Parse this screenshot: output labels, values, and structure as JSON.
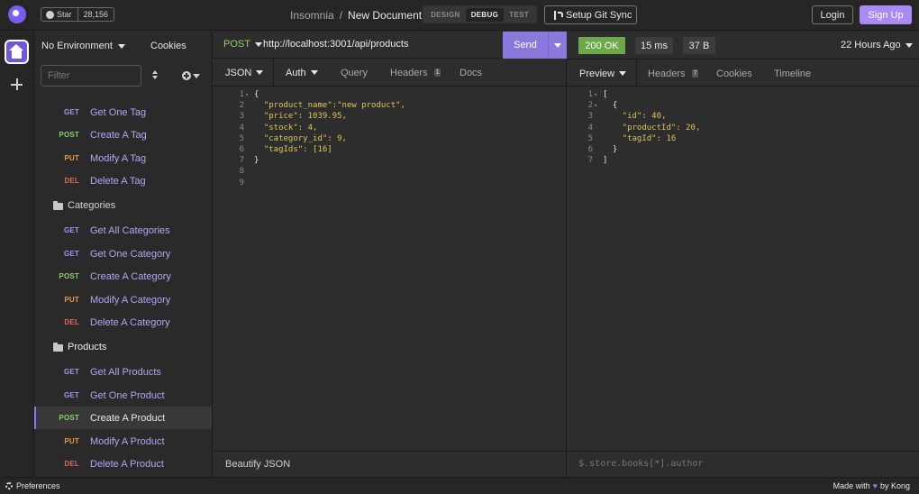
{
  "github": {
    "star_label": "Star",
    "star_count": "28,156"
  },
  "breadcrumb": {
    "workspace": "Insomnia",
    "separator": "/",
    "document": "New Document"
  },
  "modes": {
    "design": "DESIGN",
    "debug": "DEBUG",
    "test": "TEST",
    "active": "DEBUG"
  },
  "header_buttons": {
    "git_sync": "Setup Git Sync",
    "login": "Login",
    "signup": "Sign Up"
  },
  "colors": {
    "accent": "#8a78dd",
    "signup": "#a98bf3",
    "status_ok": "#6da94a",
    "get": "#a496f0",
    "post": "#8ed06c",
    "put": "#e49a4b",
    "del": "#e06868"
  },
  "sidebar": {
    "environment": "No Environment",
    "cookies": "Cookies",
    "filter_placeholder": "Filter",
    "items": [
      {
        "type": "request",
        "method": "GET",
        "name": "Get One Tag"
      },
      {
        "type": "request",
        "method": "POST",
        "name": "Create A Tag"
      },
      {
        "type": "request",
        "method": "PUT",
        "name": "Modify A Tag"
      },
      {
        "type": "request",
        "method": "DEL",
        "name": "Delete A Tag"
      },
      {
        "type": "folder",
        "name": "Categories"
      },
      {
        "type": "request",
        "method": "GET",
        "name": "Get All Categories"
      },
      {
        "type": "request",
        "method": "GET",
        "name": "Get One Category"
      },
      {
        "type": "request",
        "method": "POST",
        "name": "Create A Category"
      },
      {
        "type": "request",
        "method": "PUT",
        "name": "Modify A Category"
      },
      {
        "type": "request",
        "method": "DEL",
        "name": "Delete A Category"
      },
      {
        "type": "folder",
        "name": "Products"
      },
      {
        "type": "request",
        "method": "GET",
        "name": "Get All Products"
      },
      {
        "type": "request",
        "method": "GET",
        "name": "Get One Product"
      },
      {
        "type": "request",
        "method": "POST",
        "name": "Create A Product",
        "active": true
      },
      {
        "type": "request",
        "method": "PUT",
        "name": "Modify A Product"
      },
      {
        "type": "request",
        "method": "DEL",
        "name": "Delete A Product"
      }
    ]
  },
  "request": {
    "method": "POST",
    "url": "http://localhost:3001/api/products",
    "send_label": "Send",
    "tabs": {
      "body": "JSON",
      "auth": "Auth",
      "query": "Query",
      "headers": "Headers",
      "headers_count": "1",
      "docs": "Docs"
    },
    "body_lines": [
      "{",
      "  \"product_name\":\"new product\",",
      "  \"price\": 1039.95,",
      "  \"stock\": 4,",
      "  \"category_id\": 9,",
      "  \"tagIds\": [16]",
      "}",
      "",
      ""
    ],
    "footer": "Beautify JSON"
  },
  "response": {
    "status": "200 OK",
    "time": "15 ms",
    "size": "37 B",
    "time_ago": "22 Hours Ago",
    "tabs": {
      "preview": "Preview",
      "headers": "Headers",
      "headers_count": "7",
      "cookies": "Cookies",
      "timeline": "Timeline"
    },
    "body_lines": [
      "[",
      "  {",
      "    \"id\": 40,",
      "    \"productId\": 20,",
      "    \"tagId\": 16",
      "  }",
      "]"
    ],
    "filter_placeholder": "$.store.books[*].author"
  },
  "statusbar": {
    "preferences": "Preferences",
    "made_with": "Made with",
    "heart": "♥",
    "by": "by Kong"
  }
}
